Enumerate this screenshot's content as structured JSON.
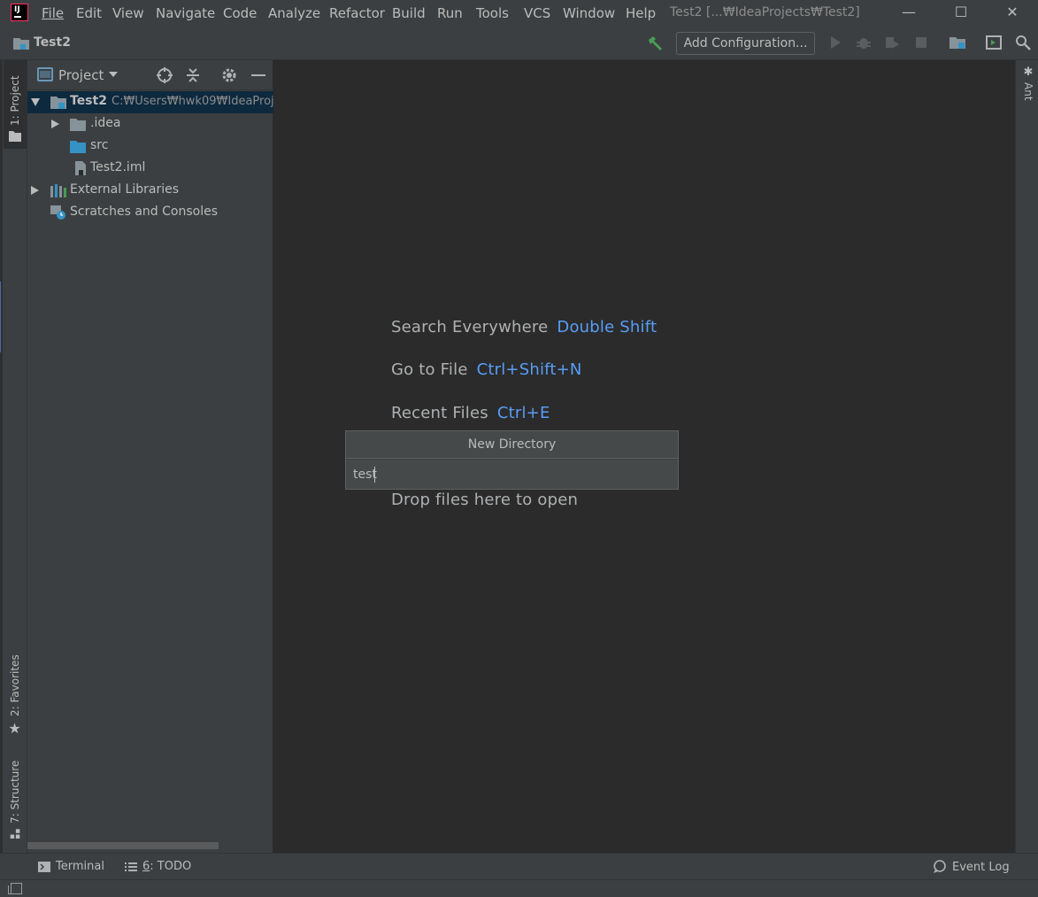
{
  "titlebar": {
    "menus": [
      "File",
      "Edit",
      "View",
      "Navigate",
      "Code",
      "Analyze",
      "Refactor",
      "Build",
      "Run",
      "Tools",
      "VCS",
      "Window",
      "Help"
    ],
    "window_title": "Test2 [...₩IdeaProjects₩Test2]",
    "controls": {
      "minimize": "—",
      "maximize": "☐",
      "close": "✕"
    }
  },
  "navbar": {
    "project_name": "Test2",
    "add_configuration": "Add Configuration..."
  },
  "left_strip": {
    "project_tab": "1: Project",
    "favorites_tab": "2: Favorites",
    "structure_tab": "7: Structure"
  },
  "project_panel": {
    "title": "Project",
    "tree": [
      {
        "label": "Test2",
        "path": "C:₩Users₩hwk09₩IdeaProj",
        "expanded": true,
        "selected": true
      },
      {
        "label": ".idea",
        "expanded": false
      },
      {
        "label": "src"
      },
      {
        "label": "Test2.iml"
      },
      {
        "label": "External Libraries",
        "expanded": false
      },
      {
        "label": "Scratches and Consoles"
      }
    ]
  },
  "editor": {
    "hints": [
      {
        "text": "Search Everywhere",
        "key": "Double Shift"
      },
      {
        "text": "Go to File",
        "key": "Ctrl+Shift+N"
      },
      {
        "text": "Recent Files",
        "key": "Ctrl+E"
      },
      {
        "text": "Drop files here to open",
        "key": ""
      }
    ]
  },
  "popup": {
    "title": "New Directory",
    "value": "test"
  },
  "right_strip": {
    "ant_tab": "Ant"
  },
  "bottombar": {
    "terminal": "Terminal",
    "todo_num": "6",
    "todo": ": TODO",
    "event_log": "Event Log"
  },
  "colors": {
    "background": "#2b2b2b",
    "panel": "#3c3f41",
    "selection": "#0d293e",
    "accent": "#589df6",
    "text": "#bbbbbb"
  }
}
